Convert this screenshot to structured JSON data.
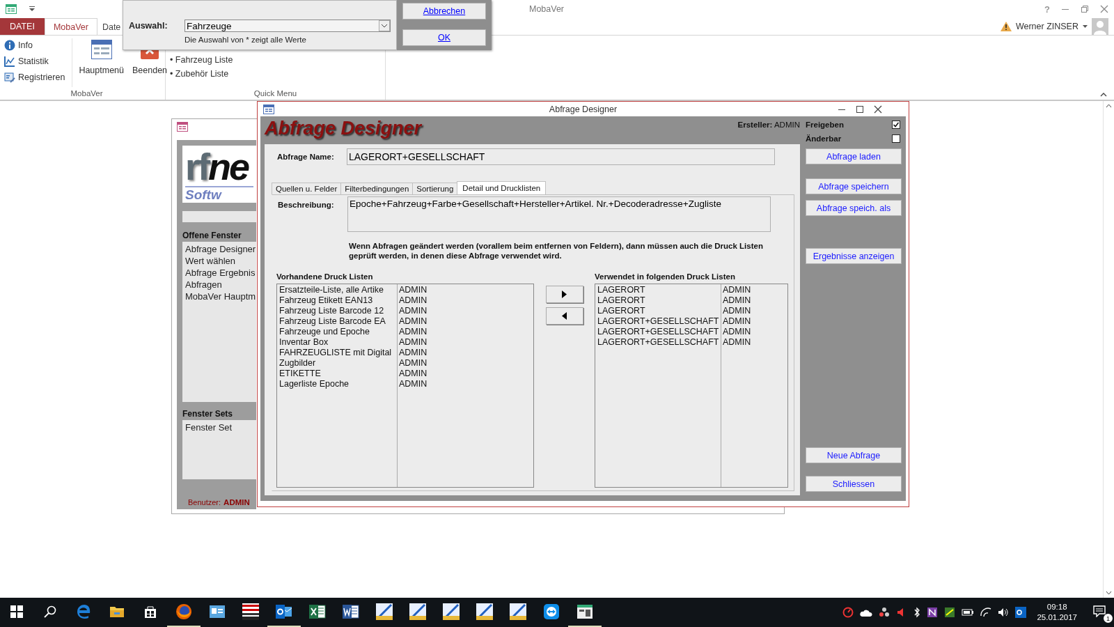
{
  "app": {
    "title": "MobaVer",
    "help": "?",
    "user": "Werner ZINSER"
  },
  "ribbon": {
    "tabs": [
      {
        "label": "DATEI",
        "kind": "file",
        "selected": false
      },
      {
        "label": "MobaVer",
        "kind": "tab",
        "selected": true
      },
      {
        "label": "Date",
        "kind": "tab",
        "selected": false
      }
    ],
    "groups": [
      {
        "label": "MobaVer",
        "small_buttons": [
          {
            "label": "Info",
            "kind": "info"
          },
          {
            "label": "Statistik",
            "kind": "chart"
          },
          {
            "label": "Registrieren",
            "kind": "register"
          }
        ],
        "large_buttons": [
          {
            "label": "Hauptmenü",
            "kind": "form"
          },
          {
            "label": "Beenden",
            "kind": "exit"
          }
        ]
      },
      {
        "label": "Quick Menu",
        "links": [
          "• Fahrzeug Liste",
          "• Zubehör Liste"
        ]
      }
    ]
  },
  "dialog": {
    "label": "Auswahl:",
    "value": "Fahrzeuge",
    "hint": "Die Auswahl von * zeigt alle Werte",
    "buttons": [
      "Abbrechen",
      "OK"
    ]
  },
  "left_window": {
    "logo_a": "rf",
    "logo_b": "ne",
    "logo_sub": "Softw",
    "sections": [
      {
        "title": "Offene Fenster",
        "items": [
          "Abfrage Designer",
          "Wert wählen",
          "Abfrage Ergebnis",
          "Abfragen",
          "MobaVer Hauptm"
        ]
      },
      {
        "title": "Fenster Sets",
        "items": [
          "Fenster Set"
        ]
      }
    ],
    "user_label": "Benutzer:",
    "user": "ADMIN"
  },
  "designer": {
    "title": "Abfrage Designer",
    "heading": "Abfrage Designer",
    "creator_label": "Ersteller:",
    "creator": "ADMIN",
    "flags": [
      {
        "label": "Freigeben",
        "checked": true
      },
      {
        "label": "Änderbar",
        "checked": false
      }
    ],
    "name_label": "Abfrage Name:",
    "name": "LAGERORT+GESELLSCHAFT",
    "tabs": [
      {
        "label": "Quellen u. Felder",
        "selected": false
      },
      {
        "label": "Filterbedingungen",
        "selected": false
      },
      {
        "label": "Sortierung",
        "selected": false
      },
      {
        "label": "Detail und Drucklisten",
        "selected": true
      }
    ],
    "description_label": "Beschreibung:",
    "description": "Epoche+Fahrzeug+Farbe+Gesellschaft+Hersteller+Artikel. Nr.+Decoderadresse+Zugliste",
    "warning": "Wenn Abfragen geändert werden (vorallem beim entfernen von Feldern), dann müssen auch die Druck Listen geprüft werden, in denen diese Abfrage verwendet wird.",
    "available": {
      "title": "Vorhandene Druck Listen",
      "rows": [
        [
          "Ersatzteile-Liste, alle Artike",
          "ADMIN"
        ],
        [
          "Fahrzeug Etikett EAN13",
          "ADMIN"
        ],
        [
          "Fahrzeug Liste Barcode 12",
          "ADMIN"
        ],
        [
          "Fahrzeug Liste Barcode EA",
          "ADMIN"
        ],
        [
          "Fahrzeuge und Epoche",
          "ADMIN"
        ],
        [
          "Inventar Box",
          "ADMIN"
        ],
        [
          "FAHRZEUGLISTE mit Digital",
          "ADMIN"
        ],
        [
          "Zugbilder",
          "ADMIN"
        ],
        [
          "ETIKETTE",
          "ADMIN"
        ],
        [
          "Lagerliste Epoche",
          "ADMIN"
        ]
      ]
    },
    "used": {
      "title": "Verwendet in folgenden Druck Listen",
      "rows": [
        [
          "LAGERORT",
          "ADMIN"
        ],
        [
          "LAGERORT",
          "ADMIN"
        ],
        [
          "LAGERORT",
          "ADMIN"
        ],
        [
          "LAGERORT+GESELLSCHAFT",
          "ADMIN"
        ],
        [
          "LAGERORT+GESELLSCHAFT",
          "ADMIN"
        ],
        [
          "LAGERORT+GESELLSCHAFT",
          "ADMIN"
        ]
      ]
    },
    "buttons": [
      {
        "label": "Abfrage laden",
        "kind": "top"
      },
      {
        "label": "Abfrage speichern",
        "kind": "top"
      },
      {
        "label": "Abfrage speich. als",
        "kind": "top"
      },
      {
        "label": "Ergebnisse anzeigen",
        "kind": "top"
      },
      {
        "label": "Neue Abfrage",
        "kind": "bottom"
      },
      {
        "label": "Schliessen",
        "kind": "bottom"
      }
    ]
  },
  "taskbar": {
    "apps": [
      {
        "kind": "start",
        "running": false
      },
      {
        "kind": "search",
        "running": false
      },
      {
        "kind": "browser",
        "running": false
      },
      {
        "kind": "folder",
        "running": false
      },
      {
        "kind": "store",
        "running": false
      },
      {
        "kind": "globe",
        "running": true
      },
      {
        "kind": "card",
        "running": false
      },
      {
        "kind": "stripes",
        "running": false
      },
      {
        "kind": "mail",
        "running": true
      },
      {
        "kind": "sheet",
        "running": false
      },
      {
        "kind": "doc",
        "running": false
      },
      {
        "kind": "diagonal",
        "running": false
      },
      {
        "kind": "diagonal",
        "running": false
      },
      {
        "kind": "diagonal",
        "running": false
      },
      {
        "kind": "diagonal",
        "running": false
      },
      {
        "kind": "diagonal",
        "running": false
      },
      {
        "kind": "remote",
        "running": false
      },
      {
        "kind": "form",
        "running": true
      }
    ],
    "time": "09:18",
    "date": "25.01.2017",
    "notifications": "1"
  }
}
